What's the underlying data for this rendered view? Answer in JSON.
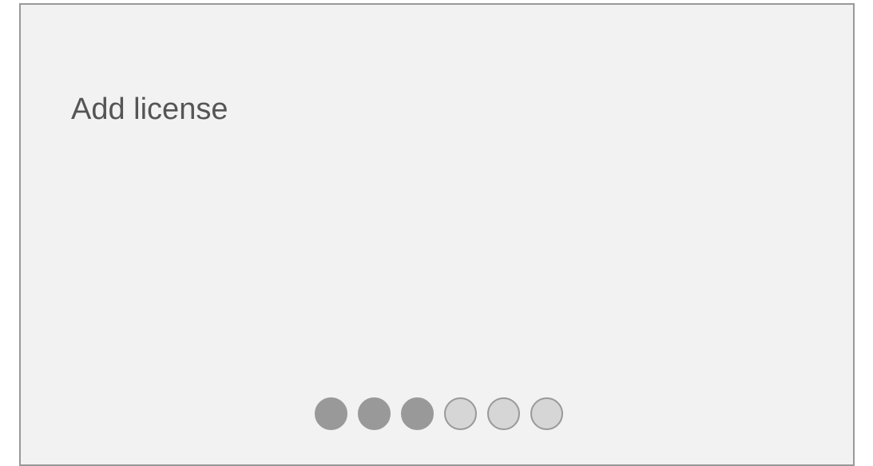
{
  "title": "Add license",
  "progress": {
    "total_steps": 6,
    "completed_steps": 3,
    "steps": [
      {
        "state": "completed"
      },
      {
        "state": "completed"
      },
      {
        "state": "completed"
      },
      {
        "state": "pending"
      },
      {
        "state": "pending"
      },
      {
        "state": "pending"
      }
    ]
  },
  "colors": {
    "panel_background": "#f2f2f2",
    "border": "#999999",
    "text": "#555555",
    "dot_filled": "#999999",
    "dot_empty": "#d6d6d6"
  }
}
